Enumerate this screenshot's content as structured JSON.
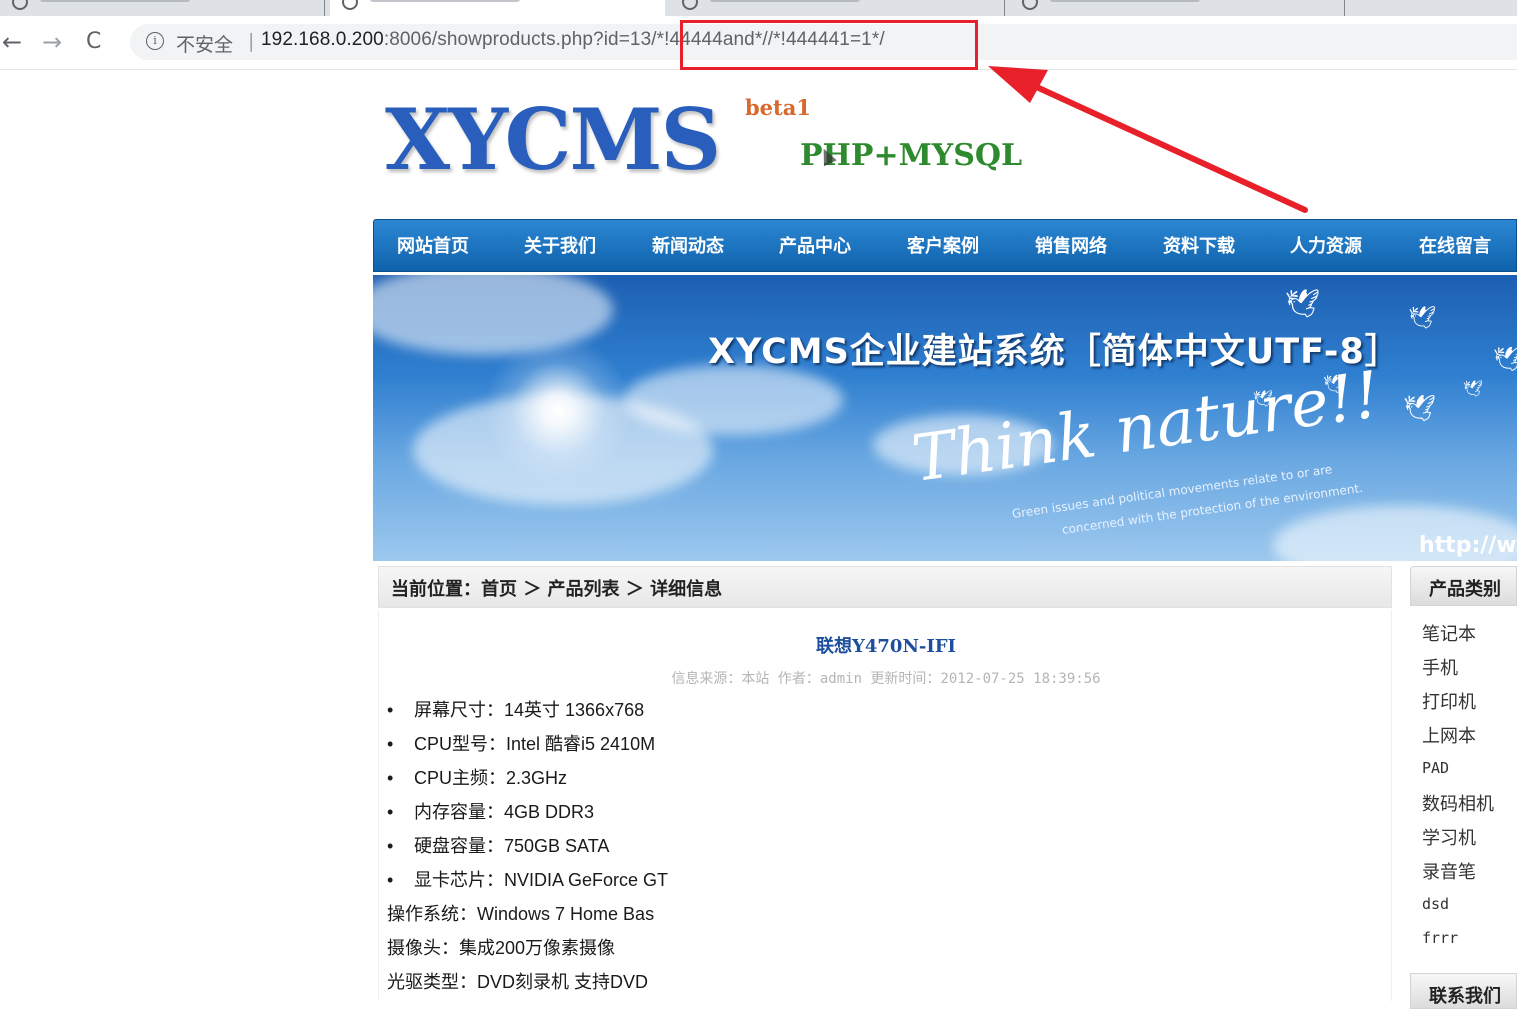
{
  "browser": {
    "url_host": "192.168.0.200",
    "url_rest": ":8006/showproducts.php?id=1",
    "url_payload": "3/*!44444and*//*!444441=1*/",
    "security_label": "不安全",
    "separator": "|",
    "info_glyph": "i",
    "back_glyph": "←",
    "forward_glyph": "→",
    "reload_glyph": "C",
    "highlight_color": "#e8202a"
  },
  "logo": {
    "main": "XYCMS",
    "badge": "beta1",
    "sub": "PHP+MYSQL"
  },
  "nav": {
    "items": [
      "网站首页",
      "关于我们",
      "新闻动态",
      "产品中心",
      "客户案例",
      "销售网络",
      "资料下载",
      "人力资源",
      "在线留言"
    ]
  },
  "banner": {
    "title": "XYCMS企业建站系统［简体中文UTF-8］",
    "slogan": "Think nature!!",
    "line1": "Green issues and political movements relate to or are",
    "line2": "concerned with the protection of the environment.",
    "url": "http://w"
  },
  "breadcrumb": "当前位置：首页 ＞ 产品列表 ＞ 详细信息",
  "product": {
    "title": "联想Y470N-IFI",
    "meta": "信息来源：本站 作者：admin 更新时间：2012-07-25 18:39:56",
    "bullets": [
      "屏幕尺寸：14英寸 1366x768",
      "CPU型号：Intel 酷睿i5 2410M",
      "CPU主频：2.3GHz",
      "内存容量：4GB DDR3",
      "硬盘容量：750GB SATA",
      "显卡芯片：NVIDIA GeForce GT"
    ],
    "lines": [
      "操作系统：Windows 7 Home Bas",
      "摄像头：集成200万像素摄像",
      "光驱类型：DVD刻录机 支持DVD"
    ]
  },
  "sidebar": {
    "heading": "产品类别",
    "categories": [
      "笔记本",
      "手机",
      "打印机",
      "上网本",
      "PAD",
      "数码相机",
      "学习机",
      "录音笔",
      "dsd",
      "frrr"
    ],
    "contact_heading": "联系我们"
  }
}
